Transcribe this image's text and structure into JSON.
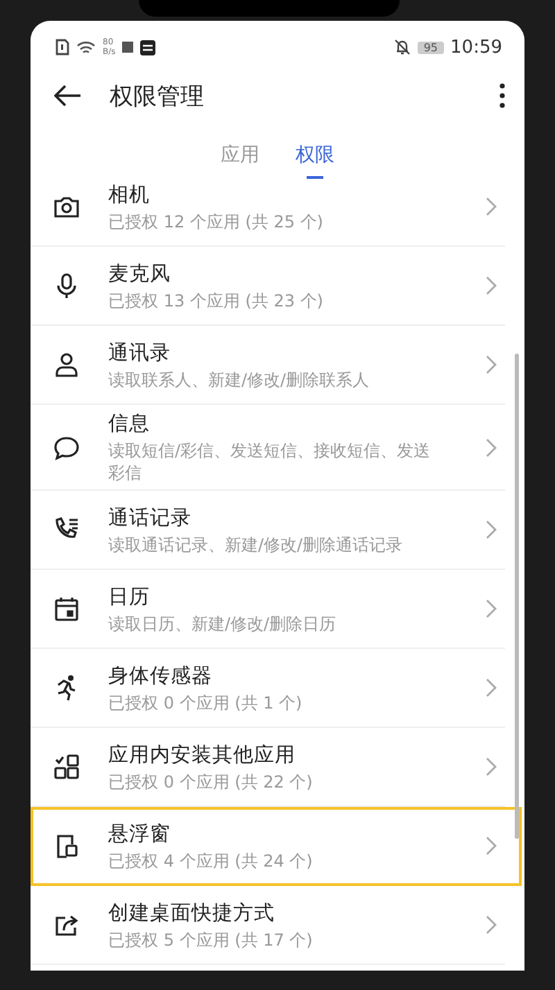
{
  "status_bar": {
    "speed_value": "80",
    "speed_unit": "B/s",
    "battery": "95",
    "time": "10:59"
  },
  "header": {
    "title": "权限管理"
  },
  "tabs": [
    {
      "label": "应用",
      "selected": false
    },
    {
      "label": "权限",
      "selected": true
    }
  ],
  "permissions": [
    {
      "title": "相机",
      "subtitle": "已授权 12 个应用 (共 25 个)",
      "highlighted": false
    },
    {
      "title": "麦克风",
      "subtitle": "已授权 13 个应用 (共 23 个)",
      "highlighted": false
    },
    {
      "title": "通讯录",
      "subtitle": "读取联系人、新建/修改/删除联系人",
      "highlighted": false
    },
    {
      "title": "信息",
      "subtitle": "读取短信/彩信、发送短信、接收短信、发送彩信",
      "highlighted": false
    },
    {
      "title": "通话记录",
      "subtitle": "读取通话记录、新建/修改/删除通话记录",
      "highlighted": false
    },
    {
      "title": "日历",
      "subtitle": "读取日历、新建/修改/删除日历",
      "highlighted": false
    },
    {
      "title": "身体传感器",
      "subtitle": "已授权 0 个应用 (共 1 个)",
      "highlighted": false
    },
    {
      "title": "应用内安装其他应用",
      "subtitle": "已授权 0 个应用 (共 22 个)",
      "highlighted": false
    },
    {
      "title": "悬浮窗",
      "subtitle": "已授权 4 个应用 (共 24 个)",
      "highlighted": true
    },
    {
      "title": "创建桌面快捷方式",
      "subtitle": "已授权 5 个应用 (共 17 个)",
      "highlighted": false
    }
  ]
}
